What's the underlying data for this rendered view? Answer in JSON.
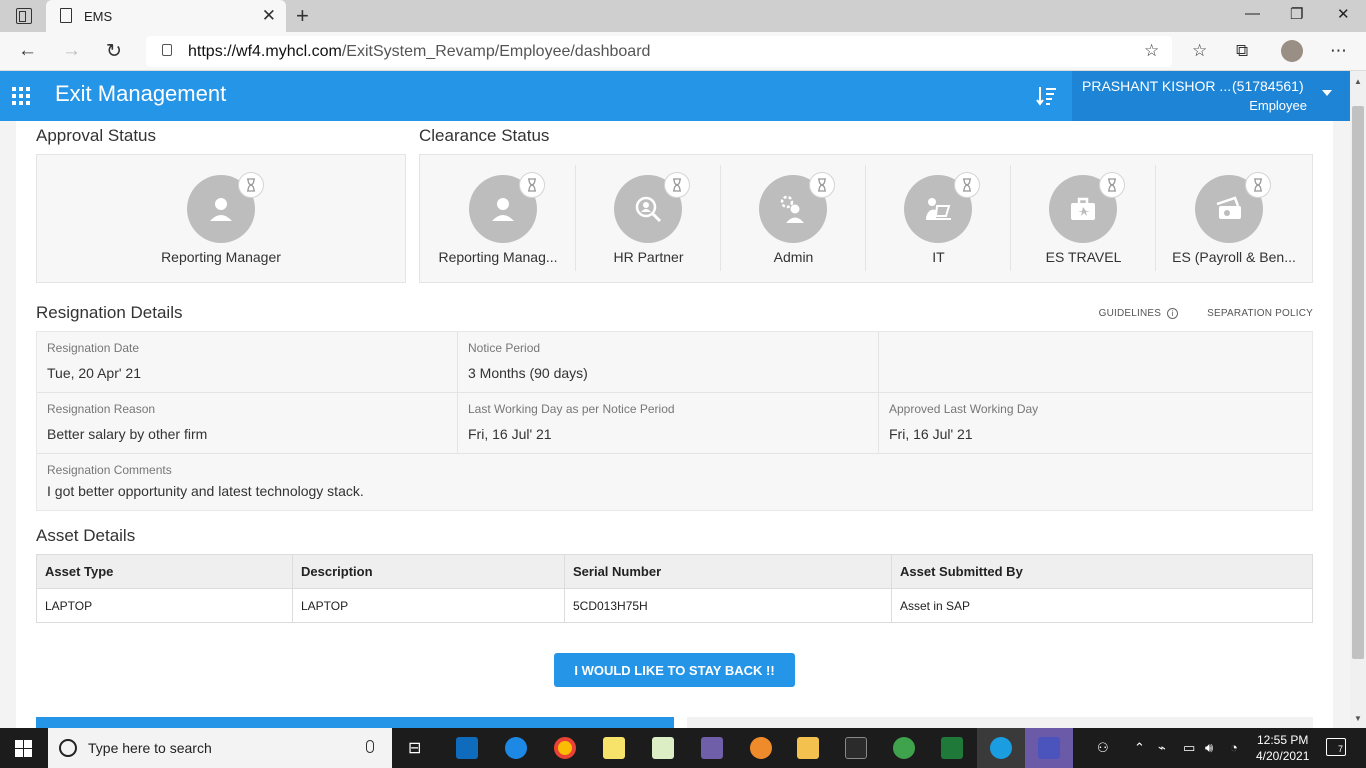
{
  "browser": {
    "tab_title": "EMS",
    "url_host": "https://wf4.myhcl.com",
    "url_path": "/ExitSystem_Revamp/Employee/dashboard"
  },
  "header": {
    "app_title": "Exit Management",
    "user_name": "PRASHANT KISHOR ...",
    "user_id": "(51784561)",
    "user_role": "Employee"
  },
  "approval": {
    "title": "Approval Status",
    "items": [
      {
        "label": "Reporting Manager",
        "icon": "person-icon"
      }
    ]
  },
  "clearance": {
    "title": "Clearance Status",
    "items": [
      {
        "label": "Reporting Manag...",
        "icon": "person-icon"
      },
      {
        "label": "HR Partner",
        "icon": "search-person-icon"
      },
      {
        "label": "Admin",
        "icon": "gear-person-icon"
      },
      {
        "label": "IT",
        "icon": "laptop-person-icon"
      },
      {
        "label": "ES TRAVEL",
        "icon": "briefcase-icon"
      },
      {
        "label": "ES (Payroll & Ben...",
        "icon": "payment-icon"
      }
    ]
  },
  "resignation": {
    "title": "Resignation Details",
    "guidelines": "GUIDELINES",
    "policy": "SEPARATION POLICY",
    "date_label": "Resignation Date",
    "date_value": "Tue, 20 Apr' 21",
    "notice_label": "Notice Period",
    "notice_value": "3 Months (90 days)",
    "reason_label": "Resignation Reason",
    "reason_value": "Better salary by other firm",
    "lwd_label": "Last Working Day as per Notice Period",
    "lwd_value": "Fri, 16 Jul' 21",
    "approved_label": "Approved Last Working Day",
    "approved_value": "Fri, 16 Jul' 21",
    "comments_label": "Resignation Comments",
    "comments_value": "I got better opportunity and latest technology stack."
  },
  "assets": {
    "title": "Asset Details",
    "columns": [
      "Asset Type",
      "Description",
      "Serial Number",
      "Asset Submitted By"
    ],
    "rows": [
      [
        "LAPTOP",
        "LAPTOP",
        "5CD013H75H",
        "Asset in SAP"
      ]
    ]
  },
  "stay_button": "I WOULD LIKE TO STAY BACK !!",
  "taskbar": {
    "search_placeholder": "Type here to search",
    "time": "12:55 PM",
    "date": "4/20/2021",
    "notifications": "7"
  },
  "colors": {
    "primary": "#2595e8",
    "user_box": "#1d84d6"
  }
}
